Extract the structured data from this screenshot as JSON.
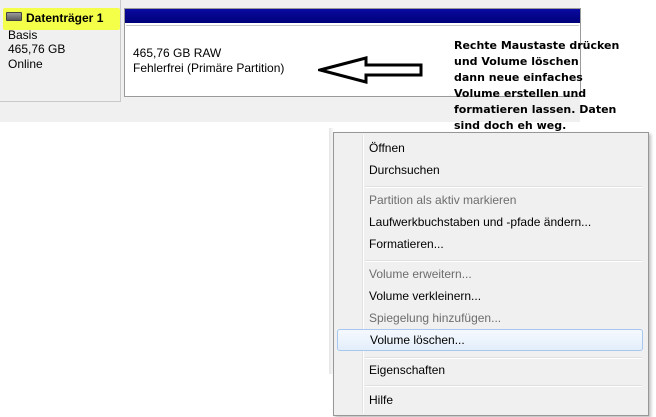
{
  "disk": {
    "title": "Datenträger 1",
    "type": "Basis",
    "size": "465,76 GB",
    "status": "Online"
  },
  "volume": {
    "size_fs": "465,76 GB RAW",
    "status": "Fehlerfrei (Primäre Partition)"
  },
  "annotation": {
    "lines": [
      "Rechte Maustaste drücken",
      "und Volume löschen",
      "dann neue einfaches",
      "Volume erstellen und",
      "formatieren lassen. Daten",
      "sind doch eh weg."
    ]
  },
  "context_menu": {
    "items": [
      {
        "label": "Öffnen",
        "enabled": true
      },
      {
        "label": "Durchsuchen",
        "enabled": true
      },
      {
        "label": "Partition als aktiv markieren",
        "enabled": false
      },
      {
        "label": "Laufwerkbuchstaben und -pfade ändern...",
        "enabled": true
      },
      {
        "label": "Formatieren...",
        "enabled": true
      },
      {
        "label": "Volume erweitern...",
        "enabled": false
      },
      {
        "label": "Volume verkleinern...",
        "enabled": true
      },
      {
        "label": "Spiegelung hinzufügen...",
        "enabled": false
      },
      {
        "label": "Volume löschen...",
        "enabled": true,
        "highlighted": true
      },
      {
        "label": "Eigenschaften",
        "enabled": true
      },
      {
        "label": "Hilfe",
        "enabled": true
      }
    ]
  },
  "colors": {
    "highlight_marker": "#f4ff4a",
    "volume_bar": "#00007a",
    "menu_hover_border": "#a8c7ee"
  }
}
